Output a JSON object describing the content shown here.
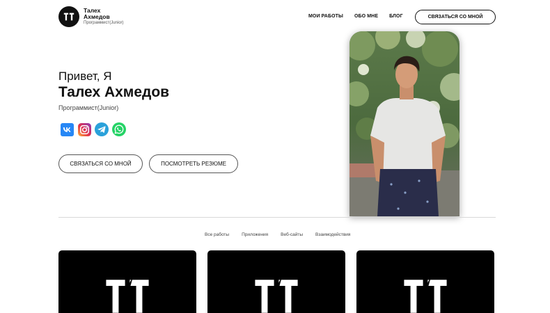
{
  "brand": {
    "name": "Талех Ахмедов",
    "subtitle": "Программист(Junior)"
  },
  "nav": {
    "items": [
      "МОИ РАБОТЫ",
      "ОБО МНЕ",
      "БЛОГ"
    ],
    "contact_button": "СВЯЗАТЬСЯ СО МНОЙ"
  },
  "hero": {
    "greeting": "Привет, Я",
    "name": "Талех Ахмедов",
    "role": "Программист(Junior)",
    "socials": [
      "vk-icon",
      "instagram-icon",
      "telegram-icon",
      "whatsapp-icon"
    ],
    "contact_button": "СВЯЗАТЬСЯ СО МНОЙ",
    "resume_button": "ПОСМОТРЕТЬ РЕЗЮМЕ"
  },
  "portfolio": {
    "filters": [
      "Все работы",
      "Приложения",
      "Веб-сайты",
      "Взаимодействия"
    ]
  },
  "colors": {
    "vk": "#2787f5",
    "telegram": "#2aa1da",
    "whatsapp": "#25d366",
    "dark": "#111111"
  }
}
